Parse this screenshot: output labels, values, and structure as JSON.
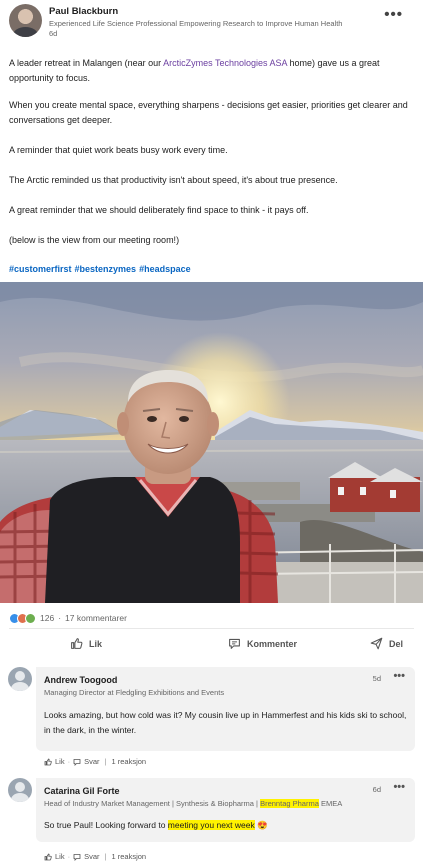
{
  "post": {
    "author": "Paul Blackburn",
    "headline": "Experienced Life Science Professional Empowering Research to Improve Human Health",
    "age": "6d",
    "more": "•••",
    "p1_a": "A leader retreat in Malangen (near our ",
    "p1_link": "ArcticZymes Technologies ASA",
    "p1_b": "  home) gave us a great opportunity to focus.",
    "p2": "When you create mental space, everything sharpens - decisions get easier, priorities get clearer and conversations get deeper.",
    "p3": "A reminder that quiet work beats busy work every time.",
    "p4": "The Arctic reminded us that productivity isn't about speed, it's about true presence.",
    "p5": "A great reminder that we should deliberately find space to think - it pays off.",
    "p6": "(below is the view from our meeting room!)",
    "hashtags": [
      "#customerfirst",
      "#bestenzymes",
      "#headspace"
    ]
  },
  "social": {
    "reactions": "126",
    "separator": "·",
    "comments": "17 kommentarer",
    "reaction_icons": [
      "like-icon",
      "heart-icon",
      "support-icon"
    ],
    "colors": {
      "like": "#378fe9",
      "heart": "#df704d",
      "support": "#6dae4f"
    }
  },
  "actions": {
    "like": "Lik",
    "comment": "Kommenter",
    "send": "Del"
  },
  "comments": [
    {
      "name": "Andrew Toogood",
      "headline": "Managing Director at Fledgling Exhibitions and Events",
      "age": "5d",
      "more": "•••",
      "text": "Looks amazing, but how cold was it?  My cousin live up in Hammerfest and his kids ski to school, in the dark, in the winter.",
      "like": "Lik",
      "reply": "Svar",
      "reactions": "1 reaksjon"
    },
    {
      "name": "Catarina Gil Forte",
      "headline_a": "Head of Industry Market Management | Synthesis & Biopharma | ",
      "headline_hl": "Brenntag Pharma",
      "headline_b": " EMEA",
      "age": "6d",
      "more": "•••",
      "text_a": "So true Paul! Looking forward to ",
      "text_hl": "meeting you next week",
      "text_b": " 😍",
      "like": "Lik",
      "reply": "Svar",
      "reactions": "1 reaksjon"
    }
  ],
  "colors": {
    "hashtag": "#0a66c2",
    "mention": "#6b3fa0",
    "highlight": "#fff200"
  }
}
